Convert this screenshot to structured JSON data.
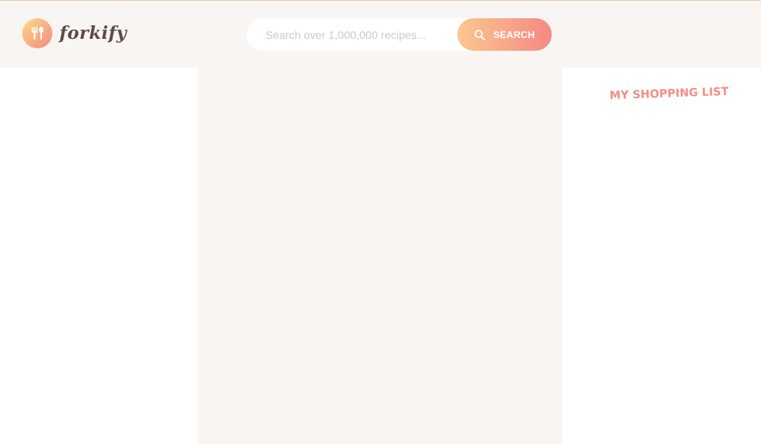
{
  "logo": {
    "text": "forkify",
    "icon": "fork-spoon-icon"
  },
  "search": {
    "placeholder": "Search over 1,000,000 recipes...",
    "value": "",
    "button_label": "SEARCH",
    "button_icon": "search-icon"
  },
  "shopping": {
    "title": "MY SHOPPING LIST"
  },
  "colors": {
    "accent": "#f38e82",
    "gradient_start": "#fbdb89",
    "gradient_end": "#f48982",
    "panel_bg": "#f9f5f3"
  }
}
